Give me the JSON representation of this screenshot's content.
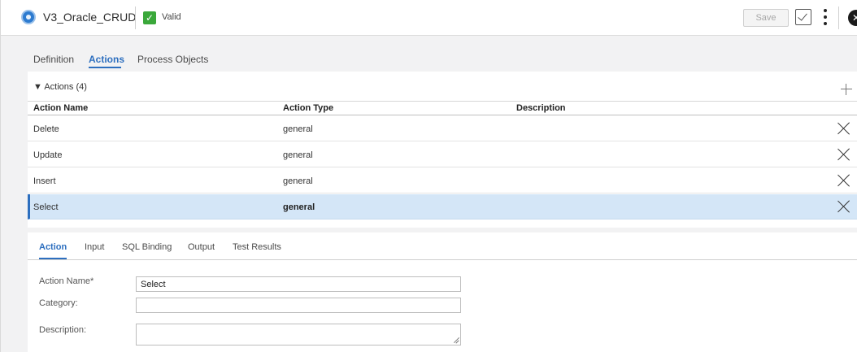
{
  "header": {
    "title": "V3_Oracle_CRUD",
    "status": "Valid",
    "save_label": "Save"
  },
  "main_tabs": [
    {
      "label": "Definition",
      "active": false
    },
    {
      "label": "Actions",
      "active": true
    },
    {
      "label": "Process Objects",
      "active": false
    }
  ],
  "actions": {
    "section_label": "Actions (4)",
    "columns": [
      "Action Name",
      "Action Type",
      "Description"
    ],
    "rows": [
      {
        "name": "Delete",
        "type": "general",
        "description": "",
        "selected": false
      },
      {
        "name": "Update",
        "type": "general",
        "description": "",
        "selected": false
      },
      {
        "name": "Insert",
        "type": "general",
        "description": "",
        "selected": false
      },
      {
        "name": "Select",
        "type": "general",
        "description": "",
        "selected": true
      }
    ]
  },
  "detail_tabs": [
    {
      "label": "Action",
      "active": true
    },
    {
      "label": "Input",
      "active": false
    },
    {
      "label": "SQL Binding",
      "active": false
    },
    {
      "label": "Output",
      "active": false
    },
    {
      "label": "Test Results",
      "active": false
    }
  ],
  "form": {
    "action_name_label": "Action Name*",
    "action_name_value": "Select",
    "category_label": "Category:",
    "category_value": "",
    "description_label": "Description:",
    "description_value": ""
  },
  "colors": {
    "accent": "#2d6fbf",
    "valid_green": "#3aa83a",
    "selected_row": "#d4e6f7"
  },
  "icons": [
    "app-icon",
    "check-icon",
    "validate-icon",
    "more-icon",
    "close-icon",
    "triangle-down-icon",
    "plus-icon",
    "delete-icon",
    "resize-icon"
  ]
}
